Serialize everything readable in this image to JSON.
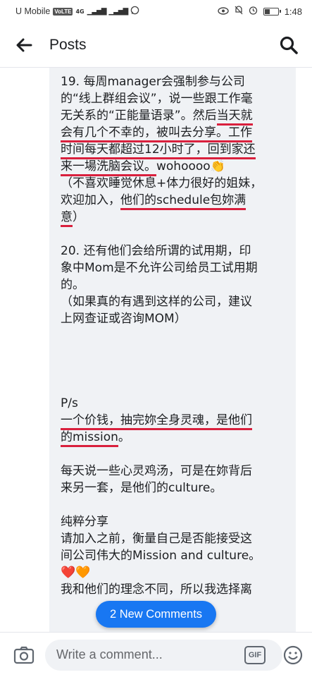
{
  "status_bar": {
    "carrier": "U Mobile",
    "volte": "VoLTE",
    "network": "4G",
    "time": "1:48",
    "battery_level": 0.4
  },
  "header": {
    "title": "Posts",
    "back_icon": "arrow-left-icon",
    "search_icon": "search-icon"
  },
  "post": {
    "lines": [
      [
        "19. 每周manager会强制参与公司"
      ],
      [
        "的“线上群组会议”，说一些跟工作毫"
      ],
      [
        "无关系的“正能量语录”。然后",
        {
          "u": "当天就"
        }
      ],
      [
        {
          "u": "会有几个不幸的，被叫去分享。"
        },
        {
          "u": "工作"
        }
      ],
      [
        {
          "u": "时间每天都超过12小时了，回到家还"
        }
      ],
      [
        {
          "u": "来一場洗脑会议。"
        },
        "wohoooo👏"
      ],
      [
        "（不喜欢睡觉休息+体力很好的姐妹，"
      ],
      [
        "欢迎加入，",
        {
          "u": "他们的schedule包妳满"
        }
      ],
      [
        {
          "u": "意"
        },
        "）"
      ],
      [],
      [
        "20. 还有他们会给所谓的试用期，印"
      ],
      [
        "象中Mom是不允许公司给员工试用期"
      ],
      [
        "的。"
      ],
      [
        "（如果真的有遇到这样的公司，建议"
      ],
      [
        "上网查证或咨询MOM）"
      ],
      [],
      [],
      [],
      [],
      [
        "P/s"
      ],
      [
        {
          "u": "一个价钱，抽完妳全身灵魂，是他们"
        }
      ],
      [
        {
          "u": "的mission"
        },
        "。"
      ],
      [],
      [
        "每天说一些心灵鸡汤，可是在妳背后"
      ],
      [
        "来另一套，是他们的culture。"
      ],
      [],
      [
        "纯粹分享"
      ],
      [
        "请加入之前，衡量自己是否能接受这"
      ],
      [
        "间公司伟大的Mission and culture。"
      ],
      [
        "❤️🧡"
      ],
      [
        "我和他们的理念不同，所以我选择离"
      ]
    ]
  },
  "new_comments_label": "2 New Comments",
  "comment_bar": {
    "placeholder": "Write a comment...",
    "gif_label": "GIF",
    "camera_icon": "camera-icon",
    "emoji_icon": "smiley-icon"
  },
  "colors": {
    "accent": "#1877f2",
    "underline": "#d9203d",
    "panel_bg": "#f0f2f5"
  }
}
